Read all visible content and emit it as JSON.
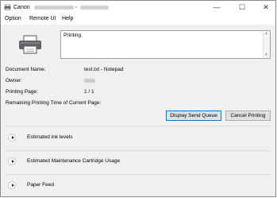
{
  "window": {
    "title": "Canon",
    "title_sep": "-",
    "controls": {
      "minimize": "—",
      "maximize": "☐",
      "close": "✕"
    }
  },
  "menu": [
    "Option",
    "Remote UI",
    "Help"
  ],
  "status": {
    "message": "Printing."
  },
  "details": {
    "document_name_label": "Document Name:",
    "document_name": "test.txt - Notepad",
    "owner_label": "Owner:",
    "printing_page_label": "Printing Page:",
    "printing_page": "1 / 1",
    "remaining_label": "Remaining Printing Time of Current Page:"
  },
  "buttons": {
    "display_send_queue": "Display Send Queue",
    "cancel_printing": "Cancel Printing"
  },
  "sections": [
    {
      "label": "Estimated ink levels"
    },
    {
      "label": "Estimated Maintenance Cartridge Usage"
    },
    {
      "label": "Paper Feed"
    }
  ],
  "icons": {
    "app": "printer-app-icon",
    "printer": "printer-icon",
    "expand": "chevron-right-icon"
  }
}
